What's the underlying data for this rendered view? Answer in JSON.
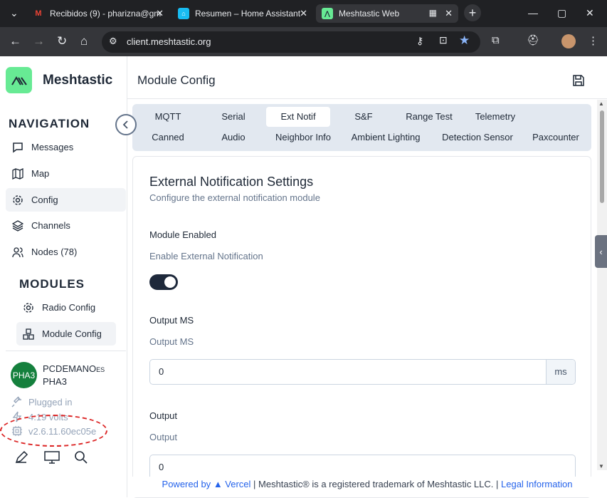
{
  "browser": {
    "tabs": [
      {
        "title": "Recibidos (9) - pharizna@gm",
        "favicon": "gmail-icon"
      },
      {
        "title": "Resumen – Home Assistant",
        "favicon": "home-assistant-icon"
      },
      {
        "title": "Meshtastic Web",
        "favicon": "meshtastic-icon"
      }
    ],
    "url": "client.meshtastic.org"
  },
  "sidebar": {
    "brand": "Meshtastic",
    "navigation_title": "NAVIGATION",
    "nav_items": [
      {
        "label": "Messages",
        "icon": "message-icon"
      },
      {
        "label": "Map",
        "icon": "map-icon"
      },
      {
        "label": "Config",
        "icon": "gear-icon"
      },
      {
        "label": "Channels",
        "icon": "layers-icon"
      },
      {
        "label": "Nodes (78)",
        "icon": "users-icon"
      }
    ],
    "modules_title": "MODULES",
    "module_items": [
      {
        "label": "Radio Config",
        "icon": "gear-icon"
      },
      {
        "label": "Module Config",
        "icon": "boxes-icon"
      }
    ],
    "device": {
      "avatar": "PHA3",
      "name": "PCDEMANO",
      "name_suffix": "ES",
      "short": "PHA3",
      "power": "Plugged in",
      "voltage": "4.19 volts",
      "firmware": "v2.6.11.60ec05e"
    }
  },
  "main": {
    "title": "Module Config",
    "tabs_row1": [
      "MQTT",
      "Serial",
      "Ext Notif",
      "S&F",
      "Range Test",
      "Telemetry"
    ],
    "tabs_row2": [
      "Canned",
      "Audio",
      "Neighbor Info",
      "Ambient Lighting",
      "Detection Sensor",
      "Paxcounter"
    ],
    "active_tab": "Ext Notif",
    "card": {
      "title": "External Notification Settings",
      "subtitle": "Configure the external notification module",
      "module_enabled_label": "Module Enabled",
      "module_enabled_desc": "Enable External Notification",
      "module_enabled": true,
      "output_ms_label": "Output MS",
      "output_ms_desc": "Output MS",
      "output_ms_value": "0",
      "output_ms_unit": "ms",
      "output_label": "Output",
      "output_desc": "Output",
      "output_value": "0"
    }
  },
  "footer": {
    "powered": "Powered by",
    "vercel": "▲ Vercel",
    "trademark": " | Meshtastic® is a registered trademark of Meshtastic LLC. | ",
    "legal": "Legal Information"
  }
}
